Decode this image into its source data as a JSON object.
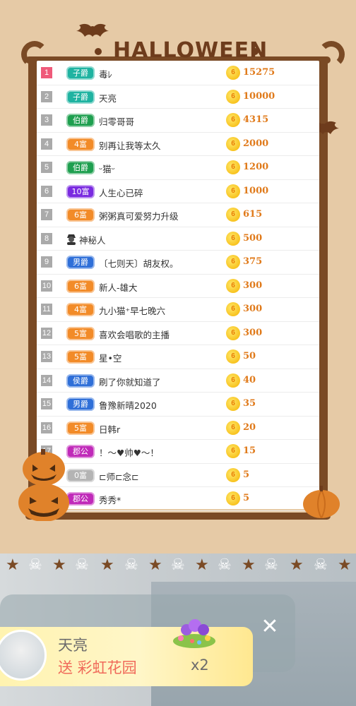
{
  "header": {
    "title": "HALLOWEEN"
  },
  "leaderboard": {
    "rows": [
      {
        "rank": "1",
        "badge": "子爵",
        "badge_style": "teal",
        "name": "毒ﾚ",
        "score": "15275"
      },
      {
        "rank": "2",
        "badge": "子爵",
        "badge_style": "teal",
        "name": "天亮",
        "score": "10000"
      },
      {
        "rank": "3",
        "badge": "伯爵",
        "badge_style": "green",
        "name": "归零哥哥",
        "score": "4315"
      },
      {
        "rank": "4",
        "badge": "4富",
        "badge_style": "orange",
        "name": "别再让我等太久",
        "score": "2000"
      },
      {
        "rank": "5",
        "badge": "伯爵",
        "badge_style": "green",
        "name": "ᵕ猫ᵕ",
        "score": "1200"
      },
      {
        "rank": "6",
        "badge": "10富",
        "badge_style": "purple",
        "name": "人生心已碎",
        "score": "1000"
      },
      {
        "rank": "7",
        "badge": "6富",
        "badge_style": "orange",
        "name": "粥粥真可爱努力升级",
        "score": "615"
      },
      {
        "rank": "8",
        "badge": "",
        "badge_style": "",
        "name": "神秘人",
        "score": "500"
      },
      {
        "rank": "9",
        "badge": "男爵",
        "badge_style": "blue",
        "name": "〔七则天〕胡友权。",
        "score": "375"
      },
      {
        "rank": "10",
        "badge": "6富",
        "badge_style": "orange",
        "name": "新人-雄大",
        "score": "300"
      },
      {
        "rank": "11",
        "badge": "4富",
        "badge_style": "orange",
        "name": "九小猫⁺早七晚六",
        "score": "300"
      },
      {
        "rank": "12",
        "badge": "5富",
        "badge_style": "orange",
        "name": "喜欢会唱歌的主播",
        "score": "300"
      },
      {
        "rank": "13",
        "badge": "5富",
        "badge_style": "orange",
        "name": "星•空",
        "score": "50"
      },
      {
        "rank": "14",
        "badge": "侯爵",
        "badge_style": "blue",
        "name": "刷了你就知道了",
        "score": "40"
      },
      {
        "rank": "15",
        "badge": "男爵",
        "badge_style": "blue",
        "name": "鲁豫新晴2020",
        "score": "35"
      },
      {
        "rank": "16",
        "badge": "5富",
        "badge_style": "orange",
        "name": "日韩r",
        "score": "20"
      },
      {
        "rank": "17",
        "badge": "郡公",
        "badge_style": "magenta",
        "name": "！～♥帅♥～！",
        "score": "15"
      },
      {
        "rank": "",
        "badge": "0富",
        "badge_style": "gray",
        "name": "⊏师⊏念⊏",
        "score": "5"
      },
      {
        "rank": "",
        "badge": "郡公",
        "badge_style": "magenta",
        "name": "秀秀*",
        "score": "5"
      }
    ]
  },
  "coin_label": "6",
  "gift_notification": {
    "user": "天亮",
    "action": "送 彩虹花园",
    "quantity": "x2",
    "close": "✕"
  }
}
